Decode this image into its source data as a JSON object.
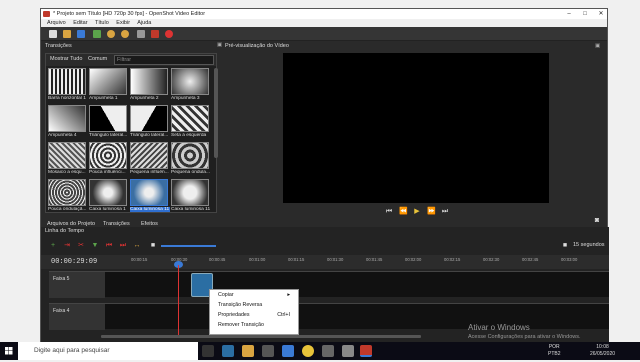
{
  "window": {
    "title": "* Projeto sem Título [HD 720p 30 fps] - OpenShot Video Editor"
  },
  "menu": [
    "Arquivo",
    "Editar",
    "Título",
    "Exibir",
    "Ajuda"
  ],
  "transitions_panel": {
    "title": "Transições",
    "show_all": "Mostrar Tudo",
    "common": "Comum",
    "filter_placeholder": "Filtrar",
    "items": [
      "Barra horizontal 1",
      "Ampunheta 1",
      "Ampunheta 2",
      "Ampunheta 3",
      "Ampunheta 4",
      "Triângulo lateral...",
      "Triângulo lateral...",
      "Seta à esquerda",
      "Mosaico a esqu...",
      "Pouca influênci...",
      "Pequena influên...",
      "Pequena ondula...",
      "Pouca ondulaçã...",
      "Caixa luminosa 1",
      "Caixa luminosa 11",
      "Caixa luminosa 11"
    ],
    "selected_index": 14
  },
  "bottom_tabs": [
    "Arquivos do Projeto",
    "Transições",
    "Efeitos"
  ],
  "preview": {
    "title": "Pré-visualização do Vídeo"
  },
  "timeline": {
    "title": "Linha do Tempo",
    "timecode": "00:00:29:09",
    "zoom_label": "15 segundos",
    "ticks": [
      "00:00:15",
      "00:00:30",
      "00:00:45",
      "00:01:00",
      "00:01:15",
      "00:01:30",
      "00:01:45",
      "00:02:00",
      "00:02:15",
      "00:02:30",
      "00:02:45",
      "00:03:00"
    ],
    "tracks": [
      "Faixa 5",
      "Faixa 4"
    ]
  },
  "context_menu": {
    "items": [
      {
        "label": "Copiar",
        "shortcut": "▸"
      },
      {
        "label": "Transição Reversa",
        "shortcut": ""
      },
      {
        "label": "Propriedades",
        "shortcut": "Ctrl+I"
      },
      {
        "label": "Remover Transição",
        "shortcut": ""
      }
    ]
  },
  "watermark": {
    "title": "Ativar o Windows",
    "subtitle": "Acesse Configurações para ativar o Windows."
  },
  "taskbar": {
    "search_placeholder": "Digite aqui para pesquisar",
    "lang1": "POR",
    "lang2": "PTB2",
    "time": "10:08",
    "date": "26/05/2020"
  },
  "colors": {
    "accent": "#3a7ad6",
    "playhead": "#dd3333"
  }
}
